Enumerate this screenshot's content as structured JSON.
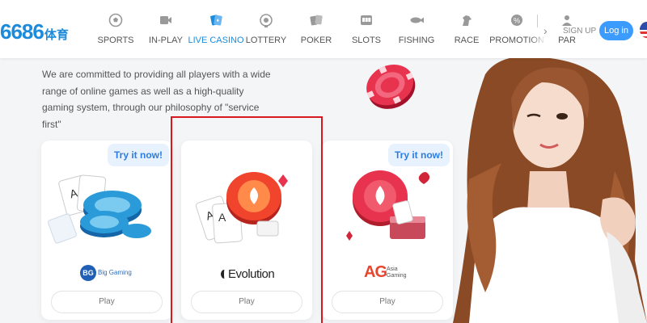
{
  "header": {
    "logo_main": "6686",
    "logo_sub": "体育",
    "nav": [
      {
        "label": "SPORTS",
        "icon": "soccer-ball-icon"
      },
      {
        "label": "IN-PLAY",
        "icon": "video-camera-icon"
      },
      {
        "label": "LIVE CASINO",
        "icon": "playing-cards-icon"
      },
      {
        "label": "LOTTERY",
        "icon": "lottery-ball-icon"
      },
      {
        "label": "POKER",
        "icon": "poker-cards-icon"
      },
      {
        "label": "SLOTS",
        "icon": "slot-machine-icon"
      },
      {
        "label": "FISHING",
        "icon": "fish-icon"
      },
      {
        "label": "RACE",
        "icon": "horse-icon"
      },
      {
        "label": "PROMOTION",
        "icon": "gift-icon"
      },
      {
        "label": "PAR",
        "icon": "partner-icon"
      }
    ],
    "active_index": 2,
    "signup_label": "SIGN UP",
    "login_label": "Log in",
    "colors": {
      "accent": "#1d8bdb",
      "login_bg": "#3b9bff"
    }
  },
  "intro_text": "We are committed to providing all players with a wide range of online games as well as a high-quality gaming system, through our philosophy of \"service first\"",
  "cards": [
    {
      "brand": "Big Gaming",
      "brand_badge": "BG",
      "try_label": "Try it now!",
      "play_label": "Play"
    },
    {
      "brand": "Evolution",
      "brand_badge": "",
      "try_label": "",
      "play_label": "Play"
    },
    {
      "brand": "Asia Gaming",
      "brand_badge": "AG",
      "try_label": "Try it now!",
      "play_label": "Play"
    }
  ]
}
